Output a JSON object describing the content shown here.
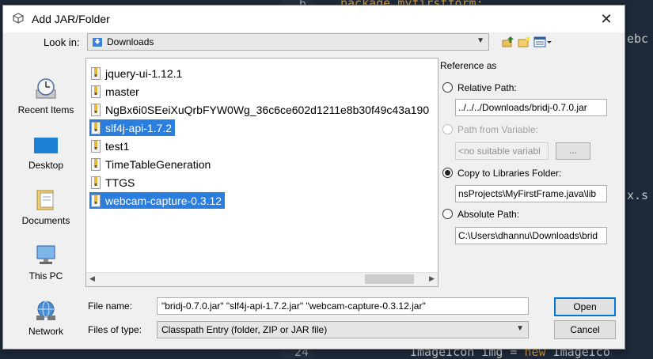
{
  "editor": {
    "line_top_code": "package myfirstform;",
    "line_top_num": "6",
    "right_frag_1": "ebc",
    "right_frag_2": "x.s",
    "bottom_line_num": "24",
    "bottom_code_prefix": "ImageIcon img = ",
    "bottom_code_kw": "new",
    "bottom_code_suffix": " ImageIco"
  },
  "dialog": {
    "title": "Add JAR/Folder",
    "close_glyph": "✕"
  },
  "look_in": {
    "label": "Look in:",
    "value": "Downloads",
    "arrow": "▼"
  },
  "places": [
    {
      "label": "Recent Items",
      "icon": "recent-items-icon"
    },
    {
      "label": "Desktop",
      "icon": "desktop-icon"
    },
    {
      "label": "Documents",
      "icon": "documents-icon"
    },
    {
      "label": "This PC",
      "icon": "this-pc-icon"
    },
    {
      "label": "Network",
      "icon": "network-icon"
    }
  ],
  "files": [
    {
      "name": "jquery-ui-1.12.1",
      "selected": false
    },
    {
      "name": "master",
      "selected": false
    },
    {
      "name": "NgBx6i0SEeiXuQrbFYW0Wg_36c6ce602d1211e8b30f49c43a190",
      "selected": false
    },
    {
      "name": "slf4j-api-1.7.2",
      "selected": true
    },
    {
      "name": "test1",
      "selected": false
    },
    {
      "name": "TimeTableGeneration",
      "selected": false
    },
    {
      "name": "TTGS",
      "selected": false
    },
    {
      "name": "webcam-capture-0.3.12",
      "selected": true
    }
  ],
  "scroll": {
    "left": "◀",
    "right": "▶"
  },
  "reference": {
    "header": "Reference as",
    "relative_label": "Relative Path:",
    "relative_value": "../../../Downloads/bridj-0.7.0.jar",
    "variable_label": "Path from Variable:",
    "variable_value": "<no suitable variabl",
    "variable_button": "...",
    "copy_label": "Copy to Libraries Folder:",
    "copy_value": "nsProjects\\MyFirstFrame.java\\lib",
    "absolute_label": "Absolute Path:",
    "absolute_value": "C:\\Users\\dhannu\\Downloads\\brid"
  },
  "bottom": {
    "file_name_label": "File name:",
    "file_name_value": "\"bridj-0.7.0.jar\" \"slf4j-api-1.7.2.jar\" \"webcam-capture-0.3.12.jar\"",
    "file_type_label": "Files of type:",
    "file_type_value": "Classpath Entry (folder, ZIP or JAR file)",
    "file_type_arrow": "▼",
    "open_label": "Open",
    "cancel_label": "Cancel"
  },
  "colors": {
    "selection": "#2a7ee0",
    "default_button_border": "#0078d7",
    "editor_bg": "#1e2a3a"
  }
}
